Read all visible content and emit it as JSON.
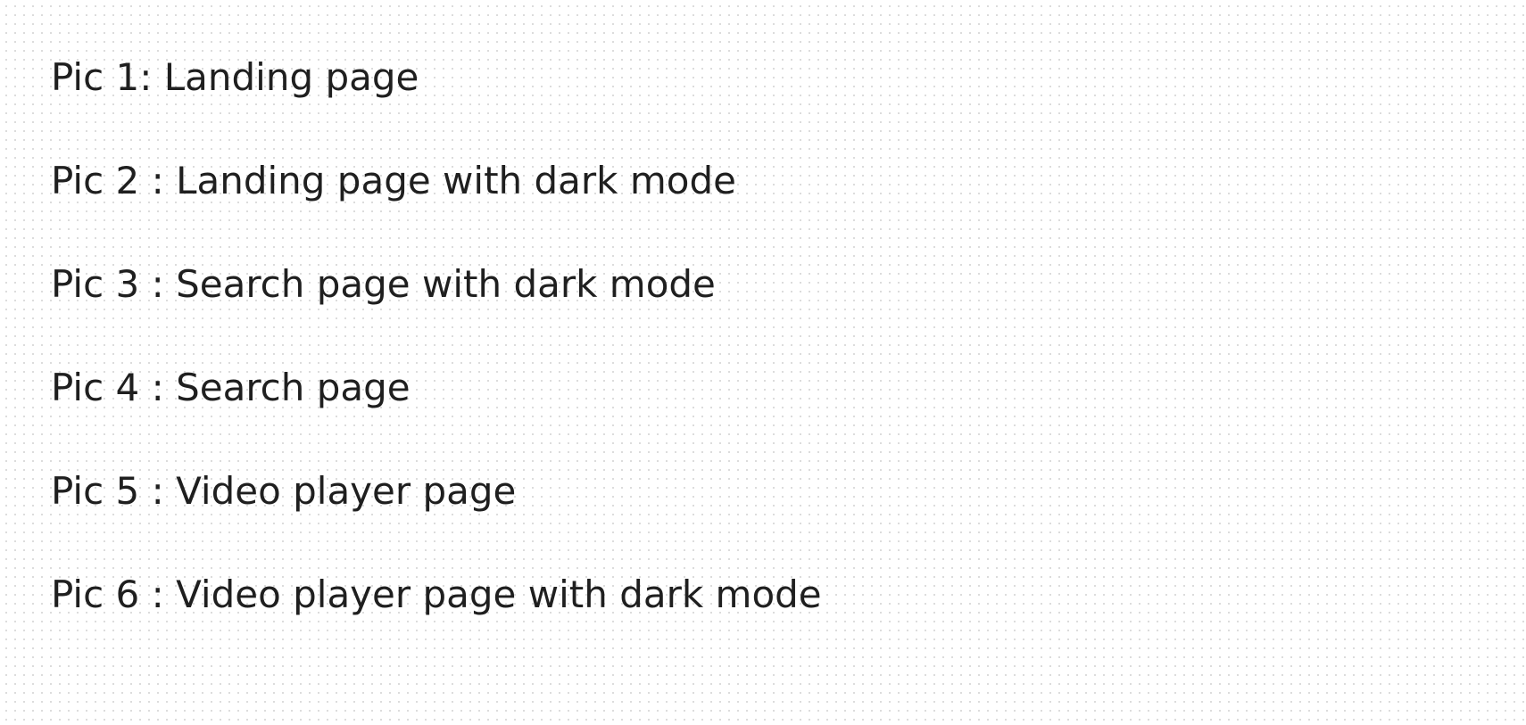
{
  "notes": {
    "lines": [
      "Pic 1: Landing page",
      "Pic 2 : Landing page with dark mode",
      "Pic 3 : Search page with dark mode",
      "Pic 4 : Search page",
      "Pic 5 : Video player page",
      "Pic 6 : Video player page with dark mode"
    ]
  },
  "colors": {
    "background": "#ffffff",
    "dot_grid": "#d9d9d9",
    "text": "#1f1f1f"
  }
}
